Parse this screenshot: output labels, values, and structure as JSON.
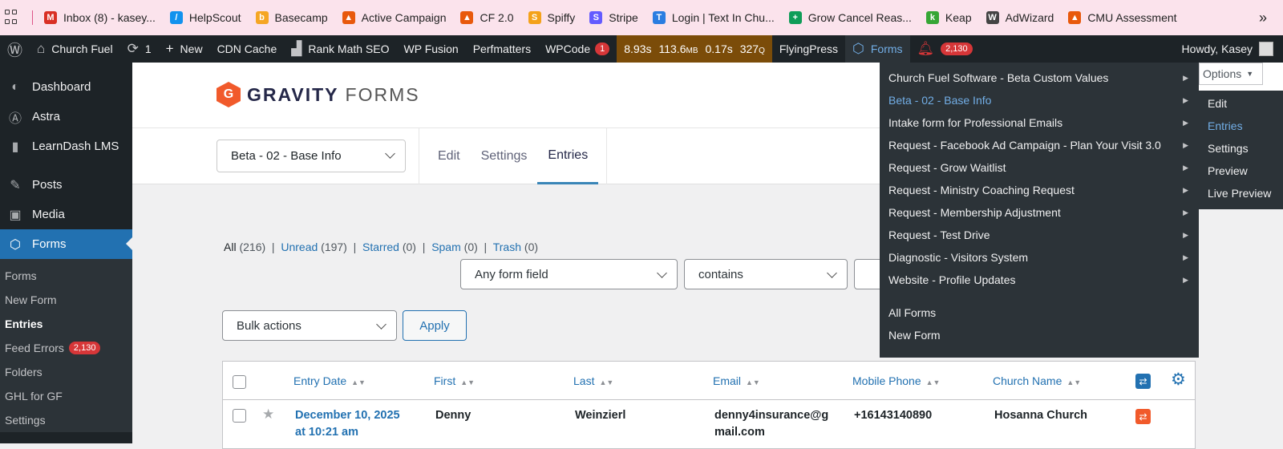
{
  "bookmarks": [
    {
      "label": "Inbox (8) - kasey...",
      "icon": "gmail-icon",
      "color": "#d93025",
      "glyph": "M"
    },
    {
      "label": "HelpScout",
      "icon": "helpscout-icon",
      "color": "#1292ee",
      "glyph": "/"
    },
    {
      "label": "Basecamp",
      "icon": "basecamp-icon",
      "color": "#f5a623",
      "glyph": "b"
    },
    {
      "label": "Active Campaign",
      "icon": "flame-icon",
      "color": "#e8590c",
      "glyph": "▲"
    },
    {
      "label": "CF 2.0",
      "icon": "flame-icon",
      "color": "#e8590c",
      "glyph": "▲"
    },
    {
      "label": "Spiffy",
      "icon": "spiffy-icon",
      "color": "#f4a21a",
      "glyph": "S"
    },
    {
      "label": "Stripe",
      "icon": "stripe-icon",
      "color": "#635bff",
      "glyph": "S"
    },
    {
      "label": "Login | Text In Chu...",
      "icon": "textinchurch-icon",
      "color": "#2a7de1",
      "glyph": "T"
    },
    {
      "label": "Grow Cancel Reas...",
      "icon": "sheets-icon",
      "color": "#0f9d58",
      "glyph": "+"
    },
    {
      "label": "Keap",
      "icon": "keap-icon",
      "color": "#36a635",
      "glyph": "k"
    },
    {
      "label": "AdWizard",
      "icon": "wizard-icon",
      "color": "#444444",
      "glyph": "W"
    },
    {
      "label": "CMU Assessment",
      "icon": "flame-icon",
      "color": "#e8590c",
      "glyph": "▲"
    }
  ],
  "bookmarks_more": "»",
  "adminbar": {
    "site": "Church Fuel",
    "updates": "1",
    "new": "New",
    "cdn": "CDN Cache",
    "rankmath": "Rank Math SEO",
    "wpfusion": "WP Fusion",
    "perfmatters": "Perfmatters",
    "wpcode": "WPCode",
    "wpcode_badge": "1",
    "perf_time": "8.93s",
    "perf_mem": "113.6",
    "perf_mem_unit": "MB",
    "perf_q_time": "0.17s",
    "perf_queries": "327",
    "perf_q_unit": "Q",
    "flyingpress": "FlyingPress",
    "forms": "Forms",
    "notif_count": "2,130",
    "howdy": "Howdy, Kasey"
  },
  "sidebar": {
    "items": [
      {
        "label": "Dashboard",
        "icon": "dashboard-icon"
      },
      {
        "label": "Astra",
        "icon": "astra-icon"
      },
      {
        "label": "LearnDash LMS",
        "icon": "learndash-icon"
      },
      {
        "label": "Posts",
        "icon": "pin-icon"
      },
      {
        "label": "Media",
        "icon": "media-icon"
      },
      {
        "label": "Forms",
        "icon": "gravityforms-icon"
      }
    ],
    "sub": [
      "Forms",
      "New Form",
      "Entries",
      "Feed Errors",
      "Folders",
      "GHL for GF",
      "Settings"
    ],
    "feed_errors_badge": "2,130"
  },
  "gf": {
    "logo_bold": "GRAVITY",
    "logo_light": "FORMS",
    "form_select": "Beta - 02 - Base Info",
    "tabs": [
      "Edit",
      "Settings",
      "Entries"
    ],
    "options": "Options"
  },
  "filters": {
    "all": "All",
    "all_count": "(216)",
    "unread": "Unread",
    "unread_count": "(197)",
    "starred": "Starred",
    "starred_count": "(0)",
    "spam": "Spam",
    "spam_count": "(0)",
    "trash": "Trash",
    "trash_count": "(0)",
    "field": "Any form field",
    "operator": "contains"
  },
  "bulk": {
    "label": "Bulk actions",
    "apply": "Apply"
  },
  "table": {
    "headers": [
      "Entry Date",
      "First",
      "Last",
      "Email",
      "Mobile Phone",
      "Church Name"
    ],
    "rows": [
      {
        "date1": "December 10, 2025",
        "date2": "at 10:21 am",
        "first": "Denny",
        "last": "Weinzierl",
        "email1": "denny4insurance@g",
        "email2": "mail.com",
        "phone": "+16143140890",
        "church": "Hosanna Church"
      }
    ]
  },
  "forms_menu": {
    "items": [
      "Church Fuel Software - Beta Custom Values",
      "Beta - 02 - Base Info",
      "Intake form for Professional Emails",
      "Request - Facebook Ad Campaign - Plan Your Visit 3.0",
      "Request - Grow Waitlist",
      "Request - Ministry Coaching Request",
      "Request - Membership Adjustment",
      "Request - Test Drive",
      "Diagnostic - Visitors System",
      "Website - Profile Updates"
    ],
    "footer": [
      "All Forms",
      "New Form"
    ],
    "submenu": [
      "Edit",
      "Entries",
      "Settings",
      "Preview",
      "Live Preview"
    ]
  },
  "colors": {
    "accent": "#2271b1",
    "gf_orange": "#f15a2b",
    "admin_bg": "#1d2327",
    "perf_bg": "#7b4c09"
  }
}
